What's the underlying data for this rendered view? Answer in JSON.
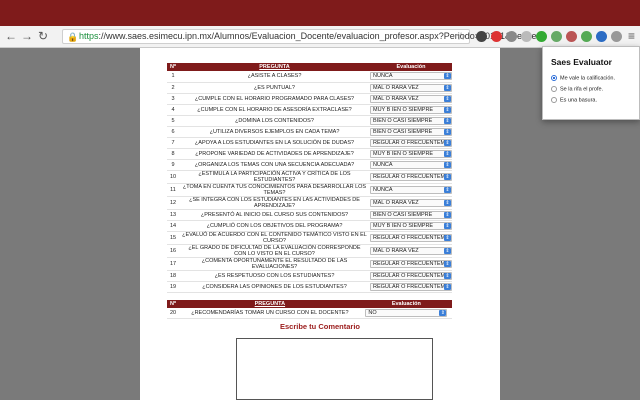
{
  "browser": {
    "url_scheme": "https",
    "url_rest": "://www.saes.esimecu.ipn.mx/Alumnos/Evaluacion_Docente/evaluacion_profesor.aspx?Periodo=20161&Secue..."
  },
  "table1": {
    "headers": {
      "num": "Nº",
      "question": "PREGUNTA",
      "eval": "Evaluación"
    },
    "rows": [
      {
        "num": "1",
        "q": "¿ASISTE A CLASES?",
        "v": "NUNCA"
      },
      {
        "num": "2",
        "q": "¿ES PUNTUAL?",
        "v": "MAL O RARA VEZ"
      },
      {
        "num": "3",
        "q": "¿CUMPLE CON EL HORARIO PROGRAMADO PARA CLASES?",
        "v": "MAL O RARA VEZ"
      },
      {
        "num": "4",
        "q": "¿CUMPLE CON EL HORARIO DE ASESORÍA EXTRACLASE?",
        "v": "MUY B IEN O SIEMPRE"
      },
      {
        "num": "5",
        "q": "¿DOMINA LOS CONTENIDOS?",
        "v": "BIEN O CASI SIEMPRE"
      },
      {
        "num": "6",
        "q": "¿UTILIZA DIVERSOS EJEMPLOS EN CADA TEMA?",
        "v": "BIEN O CASI SIEMPRE"
      },
      {
        "num": "7",
        "q": "¿APOYA A LOS ESTUDIANTES EN LA SOLUCIÓN DE DUDAS?",
        "v": "REGULAR O FRECUENTEM"
      },
      {
        "num": "8",
        "q": "¿PROPONE VARIEDAD DE ACTIVIDADES DE APRENDIZAJE?",
        "v": "MUY B IEN O SIEMPRE"
      },
      {
        "num": "9",
        "q": "¿ORGANIZA LOS TEMAS CON UNA SECUENCIA ADECUADA?",
        "v": "NUNCA"
      },
      {
        "num": "10",
        "q": "¿ESTIMULA LA PARTICIPACIÓN ACTIVA Y CRÍTICA DE LOS ESTUDIANTES?",
        "v": "REGULAR O FRECUENTEM"
      },
      {
        "num": "11",
        "q": "¿TOMA EN CUENTA TUS CONOCIMIENTOS PARA DESARROLLAR LOS TEMAS?",
        "v": "NUNCA"
      },
      {
        "num": "12",
        "q": "¿SE INTEGRA CON LOS ESTUDIANTES EN LAS ACTIVIDADES DE APRENDIZAJE?",
        "v": "MAL O RARA VEZ"
      },
      {
        "num": "13",
        "q": "¿PRESENTÓ AL INICIO DEL CURSO SUS CONTENIDOS?",
        "v": "BIEN O CASI SIEMPRE"
      },
      {
        "num": "14",
        "q": "¿CUMPLIÓ CON LOS OBJETIVOS DEL PROGRAMA?",
        "v": "MUY B IEN O SIEMPRE"
      },
      {
        "num": "15",
        "q": "¿EVALUÓ DE ACUERDO CON EL CONTENIDO TEMÁTICO VISTO EN EL CURSO?",
        "v": "REGULAR O FRECUENTEM"
      },
      {
        "num": "16",
        "q": "¿EL GRADO DE DIFICULTAD DE LA EVALUACIÓN CORRESPONDE CON LO VISTO EN EL CURSO?",
        "v": "MAL O RARA VEZ"
      },
      {
        "num": "17",
        "q": "¿COMENTA OPORTUNAMENTE EL RESULTADO DE LAS EVALUACIONES?",
        "v": "REGULAR O FRECUENTEM"
      },
      {
        "num": "18",
        "q": "¿ES RESPETUOSO CON LOS ESTUDIANTES?",
        "v": "REGULAR O FRECUENTEM"
      },
      {
        "num": "19",
        "q": "¿CONSIDERA LAS OPINIONES DE LOS ESTUDIANTES?",
        "v": "REGULAR O FRECUENTEM"
      }
    ]
  },
  "table2": {
    "headers": {
      "num": "Nº",
      "question": "PREGUNTA",
      "eval": "Evaluación"
    },
    "rows": [
      {
        "num": "20",
        "q": "¿RECOMENDARÍAS TOMAR UN CURSO CON EL DOCENTE?",
        "v": "NO"
      }
    ]
  },
  "comment": {
    "title": "Escribe tu Comentario"
  },
  "popup": {
    "title": "Saes Evaluator",
    "options": [
      "Me vale la calificación.",
      "Se la rifa el profe.",
      "Es una basura."
    ],
    "selected_index": 0
  },
  "colors": {
    "brand": "#7f1b1b",
    "accent": "#3b7fd8"
  }
}
